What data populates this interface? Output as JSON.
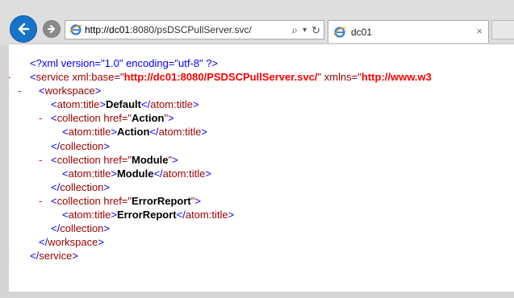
{
  "nav": {
    "address_host": "http://dc01",
    "address_rest": ":8080/psDSCPullServer.svc/",
    "search_symbol": "⌕",
    "dropdown_symbol": "▾",
    "refresh_symbol": "↻",
    "back_icon": "back-arrow-icon",
    "forward_icon": "forward-arrow-icon"
  },
  "tab": {
    "title": "dc01",
    "close": "×"
  },
  "xml_lines": {
    "l1": "<?xml version=\"1.0\" encoding=\"utf-8\" ?>",
    "l2_minus": "-",
    "l2_open": "<",
    "l2_tag": "service",
    "l2_attr1": " xml:base=\"",
    "l2_val1": "http://dc01:8080/PSDSCPullServer.svc/",
    "l2_attr2": "\" xmlns=\"",
    "l2_val2": "http://www.w3",
    "l3_minus": "-",
    "l3_open": "<",
    "l3_tag": "workspace",
    "l3_close": ">",
    "l4_open": "<",
    "l4_tag": "atom:title",
    "l4_gt": ">",
    "l4_text": "Default",
    "l4_end": "</",
    "l4_endtag": "atom:title",
    "l4_endgt": ">",
    "c1_minus": "-",
    "c1_open": "<",
    "c1_tag": "collection",
    "c1_attr": " href=\"",
    "c1_val": "Action",
    "c1_q": "\"",
    "c1_gt": ">",
    "c1_title_text": "Action",
    "c2_val": "Module",
    "c2_title_text": "Module",
    "c3_val": "ErrorReport",
    "c3_title_text": "ErrorReport",
    "coll_close_tag": "collection",
    "ws_close_tag": "workspace",
    "svc_close_tag": "service",
    "lt_slash": "</",
    "gt": ">"
  }
}
